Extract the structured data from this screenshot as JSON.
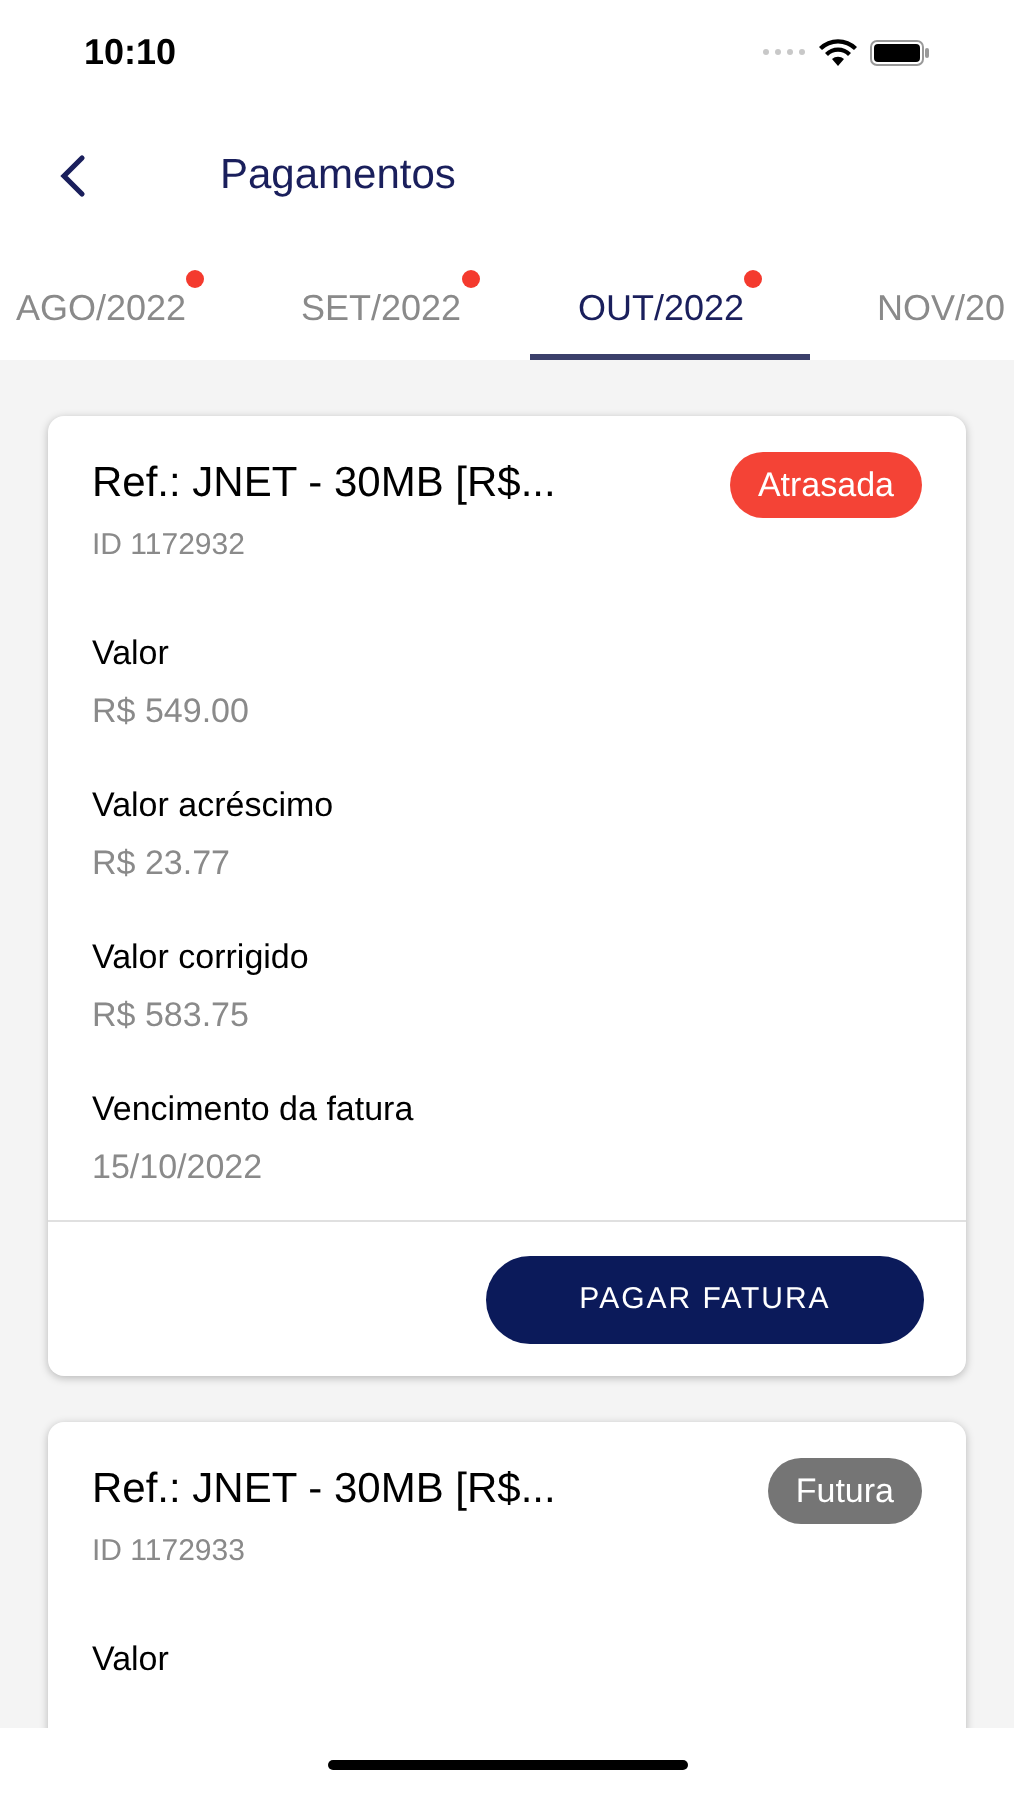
{
  "status_bar": {
    "time": "10:10"
  },
  "header": {
    "title": "Pagamentos"
  },
  "tabs": [
    {
      "label": "AGO/2022",
      "selected": false,
      "badge": true
    },
    {
      "label": "SET/2022",
      "selected": false,
      "badge": true
    },
    {
      "label": "OUT/2022",
      "selected": true,
      "badge": true
    },
    {
      "label": "NOV/20",
      "selected": false,
      "badge": false
    }
  ],
  "invoices": [
    {
      "title": "Ref.: JNET - 30MB [R$...",
      "id": "ID 1172932",
      "status": {
        "label": "Atrasada",
        "kind": "overdue"
      },
      "fields": [
        {
          "label": "Valor",
          "value": "R$ 549.00"
        },
        {
          "label": "Valor acréscimo",
          "value": "R$ 23.77"
        },
        {
          "label": "Valor corrigido",
          "value": "R$ 583.75"
        },
        {
          "label": "Vencimento da fatura",
          "value": "15/10/2022"
        }
      ],
      "button": "PAGAR FATURA"
    },
    {
      "title": "Ref.: JNET - 30MB [R$...",
      "id": "ID 1172933",
      "status": {
        "label": "Futura",
        "kind": "future"
      },
      "fields": [
        {
          "label": "Valor"
        }
      ]
    }
  ]
}
